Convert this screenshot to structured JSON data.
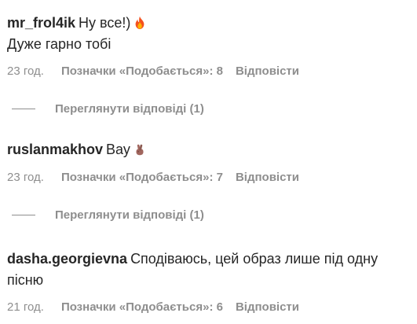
{
  "comments": [
    {
      "username": "mr_frol4ik",
      "text": "Ну все!)",
      "text_line2": "Дуже гарно тобі",
      "emoji": "fire-emoji",
      "time": "23 год.",
      "likes": "Позначки «Подобається»: 8",
      "reply": "Відповісти",
      "view_replies": "Переглянути відповіді (1)"
    },
    {
      "username": "ruslanmakhov",
      "text": "Вау",
      "emoji": "crossed-fingers-emoji",
      "time": "23 год.",
      "likes": "Позначки «Подобається»: 7",
      "reply": "Відповісти",
      "view_replies": "Переглянути відповіді (1)"
    },
    {
      "username": "dasha.georgievna",
      "text": "Сподіваюсь, цей образ лише під одну пісню",
      "time": "21 год.",
      "likes": "Позначки «Подобається»: 6",
      "reply": "Відповісти"
    }
  ],
  "colors": {
    "text": "#262626",
    "secondary": "#8e8e8e",
    "background": "#ffffff"
  }
}
